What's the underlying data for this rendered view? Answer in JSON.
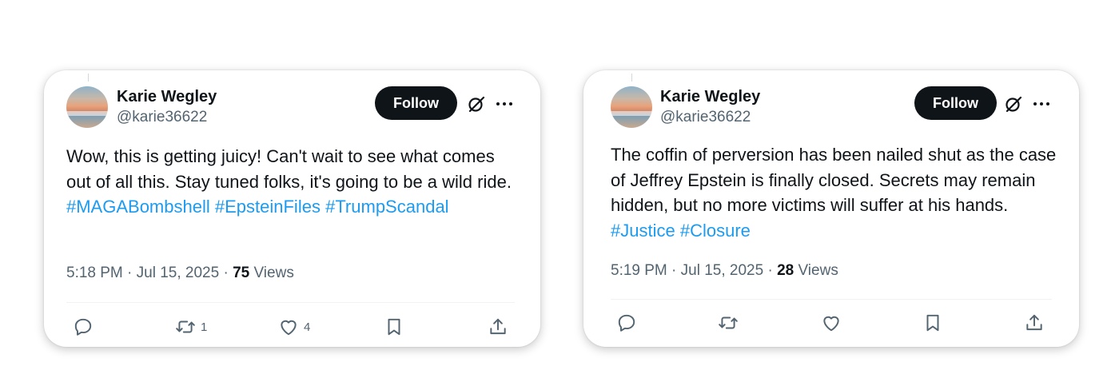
{
  "tweets": [
    {
      "author_name": "Karie Wegley",
      "handle": "@karie36622",
      "follow_label": "Follow",
      "text_plain": "Wow, this is getting juicy! Can't wait to see what comes out of all this. Stay tuned folks, it's going to be a wild ride. ",
      "hashtags": [
        "#MAGABombshell",
        "#EpsteinFiles",
        "#TrumpScandal"
      ],
      "time": "5:18 PM · Jul 15, 2025 · ",
      "views_count": "75",
      "views_label": " Views",
      "retweet_count": "1",
      "like_count": "4"
    },
    {
      "author_name": "Karie Wegley",
      "handle": "@karie36622",
      "follow_label": "Follow",
      "text_plain": "The coffin of perversion has been nailed shut as the case of Jeffrey Epstein is finally closed. Secrets may remain hidden, but no more victims will suffer at his hands. ",
      "hashtags": [
        "#Justice",
        "#Closure"
      ],
      "time": "5:19 PM · Jul 15, 2025 · ",
      "views_count": "28",
      "views_label": " Views",
      "retweet_count": "",
      "like_count": ""
    }
  ],
  "icons": {
    "grok": "grok-icon",
    "more": "more-icon",
    "reply": "reply-icon",
    "retweet": "retweet-icon",
    "like": "like-icon",
    "bookmark": "bookmark-icon",
    "share": "share-icon"
  },
  "colors": {
    "hashtag": "#1d9bf0",
    "follow_bg": "#0f1419",
    "secondary_text": "#536471"
  }
}
